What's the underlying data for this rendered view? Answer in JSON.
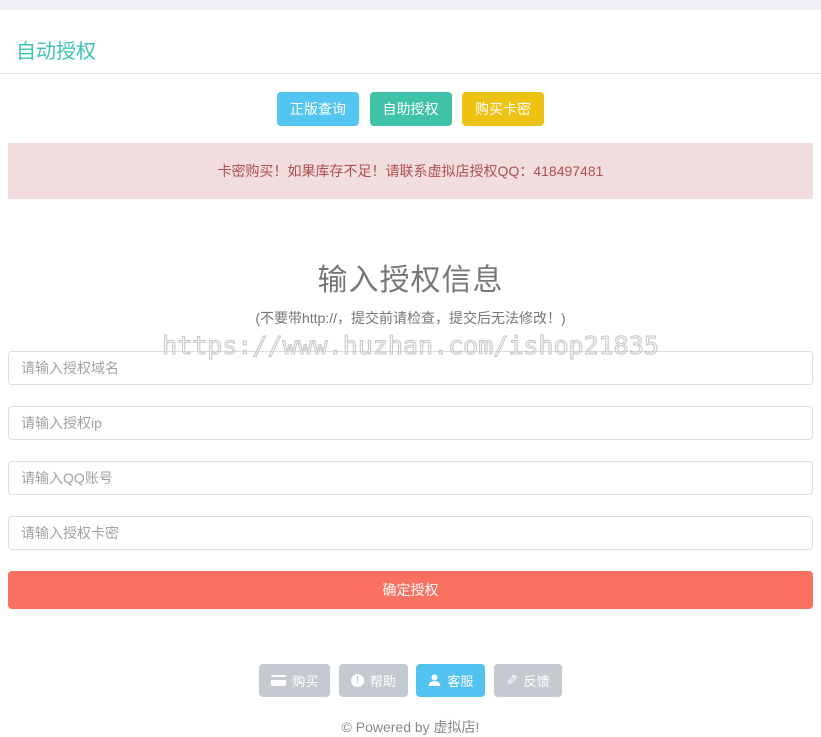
{
  "page": {
    "title": "自动授权",
    "footer": "© Powered by 虚拟店!"
  },
  "nav_buttons": [
    {
      "label": "正版查询",
      "color": "#53c6f0"
    },
    {
      "label": "自助授权",
      "color": "#3fc2a7"
    },
    {
      "label": "购买卡密",
      "color": "#eec213"
    }
  ],
  "alert": {
    "text": "卡密购买！如果库存不足！请联系虚拟店授权QQ：418497481",
    "background": "#f1dddd",
    "text_color": "#b05050"
  },
  "form": {
    "title": "输入授权信息",
    "subtitle": "(不要带http://，提交前请检查，提交后无法修改！)",
    "fields": [
      {
        "name": "domain",
        "placeholder": "请输入授权域名",
        "value": ""
      },
      {
        "name": "ip",
        "placeholder": "请输入授权ip",
        "value": ""
      },
      {
        "name": "qq",
        "placeholder": "请输入QQ账号",
        "value": ""
      },
      {
        "name": "card_key",
        "placeholder": "请输入授权卡密",
        "value": ""
      }
    ],
    "submit_label": "确定授权",
    "submit_color": "#fa7061"
  },
  "watermark": "https://www.huzhan.com/ishop21835",
  "footer_buttons": [
    {
      "label": "购买",
      "icon": "credit-card-icon",
      "active": false
    },
    {
      "label": "帮助",
      "icon": "info-circle-icon",
      "active": false
    },
    {
      "label": "客服",
      "icon": "user-icon",
      "active": true
    },
    {
      "label": "反馈",
      "icon": "pencil-icon",
      "active": false
    }
  ],
  "colors": {
    "top_bar": "#eef0f5",
    "heading_accent": "#3bc2b2",
    "inactive_footer_button": "#c4cad0",
    "active_footer_button": "#52c2f0"
  }
}
